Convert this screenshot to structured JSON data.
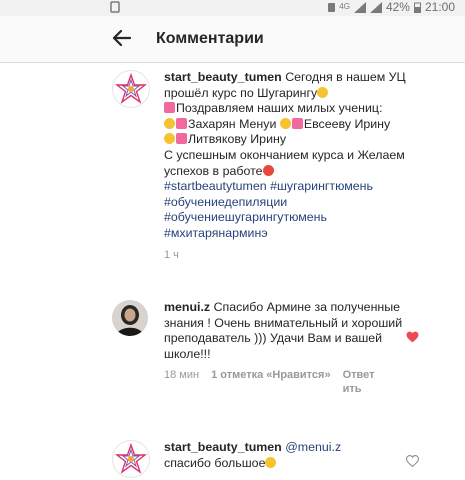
{
  "status_bar": {
    "battery": "42%",
    "time": "21:00"
  },
  "header": {
    "title": "Комментарии"
  },
  "comments": [
    {
      "username": "start_beauty_tumen",
      "text1": " Сегодня в нашем УЦ прошёл курс по Шугарингу",
      "text2": "Поздравляем наших милых учениц:",
      "text3": "Захарян Менуи ",
      "text4": "Евсееву Ирину",
      "text5": "Литвякову Ирину",
      "text6": "С успешным окончанием курса и Желаем успехов в работе",
      "hashtags": [
        "#startbeautytumen",
        "#шугарингтюмень",
        "#обучениедепиляции",
        "#обучениешугарингутюмень",
        "#мхитарянарминэ"
      ],
      "time": "1 ч"
    },
    {
      "username": "menui.z",
      "text": " Спасибо Армине за полученные знания ! Очень внимательный и хороший преподаватель ))) Удачи Вам и вашей школе!!!",
      "time": "18 мин",
      "likes": "1 отметка «Нравится»",
      "reply": "Ответить"
    },
    {
      "username": "start_beauty_tumen",
      "mention": "@menui.z",
      "text": "спасибо большое"
    }
  ],
  "colors": {
    "hashtag": "#27437a",
    "heart_liked": "#ed4956",
    "meta_gray": "#999999"
  }
}
